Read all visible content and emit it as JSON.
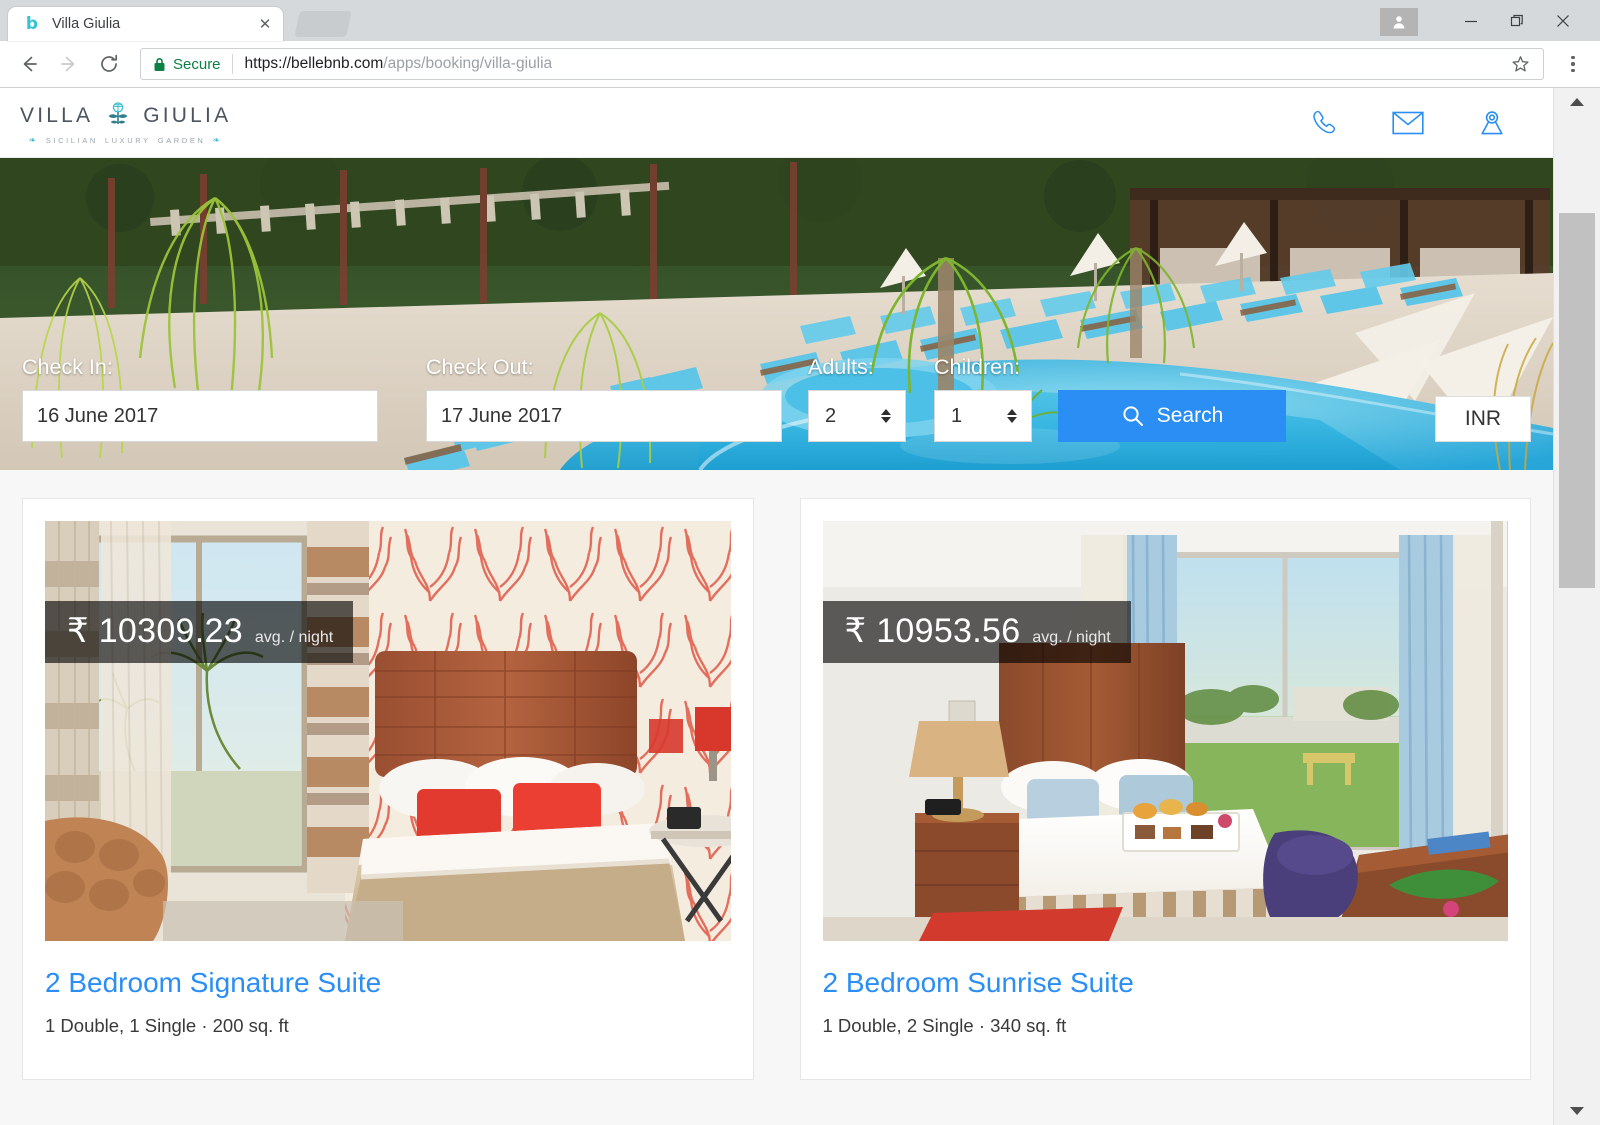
{
  "browser": {
    "tab": {
      "title": "Villa Giulia",
      "favicon": "b",
      "close_label": "✕"
    },
    "window": {
      "minimize": "–",
      "maximize": "❐",
      "close": "✕",
      "avatar": "profile-avatar"
    },
    "toolbar": {
      "back": "←",
      "forward": "→",
      "reload": "⟳",
      "secure_label": "Secure",
      "url_host": "https://bellebnb.com",
      "url_path": "/apps/booking/villa-giulia",
      "bookmark": "☆",
      "menu": "⋮"
    }
  },
  "site": {
    "logo": {
      "word_left": "VILLA",
      "word_right": "GIULIA",
      "tagline_1": "SICILIAN",
      "tagline_2": "LUXURY",
      "tagline_3": "GARDEN"
    },
    "header_icons": [
      {
        "name": "phone-icon",
        "label": "Call"
      },
      {
        "name": "mail-icon",
        "label": "Email"
      },
      {
        "name": "map-pin-icon",
        "label": "Location"
      }
    ]
  },
  "search": {
    "checkin_label": "Check In:",
    "checkin_value": "16 June 2017",
    "checkout_label": "Check Out:",
    "checkout_value": "17 June 2017",
    "adults_label": "Adults:",
    "adults_value": "2",
    "children_label": "Children:",
    "children_value": "1",
    "search_button": "Search",
    "currency": "INR"
  },
  "rooms": [
    {
      "price_symbol": "₹",
      "price": "10309.23",
      "price_unit": "avg. / night",
      "title": "2 Bedroom Signature Suite",
      "meta": "1 Double, 1 Single · 200 sq. ft"
    },
    {
      "price_symbol": "₹",
      "price": "10953.56",
      "price_unit": "avg. / night",
      "title": "2 Bedroom Sunrise Suite",
      "meta": "1 Double, 2 Single · 340 sq. ft"
    }
  ],
  "colors": {
    "accent_blue": "#2a8ef4",
    "logo_teal": "#3fc1cf",
    "secure_green": "#0b8043",
    "page_bg": "#f7f7f7"
  }
}
